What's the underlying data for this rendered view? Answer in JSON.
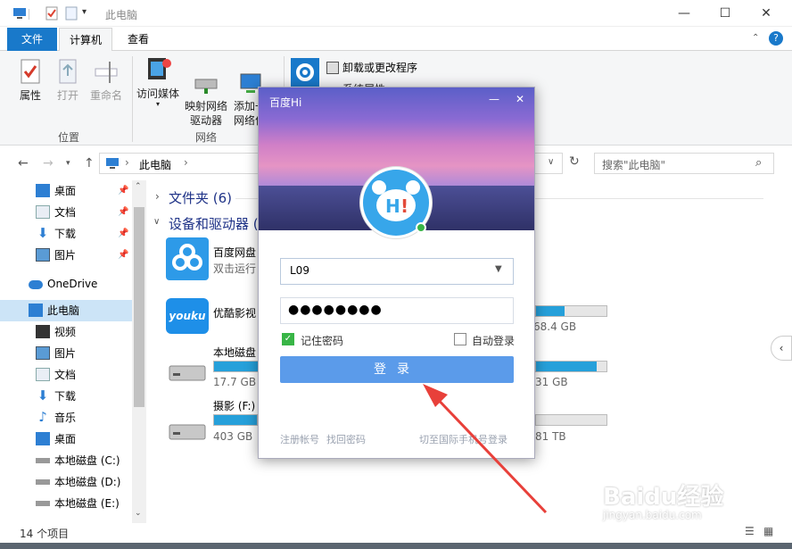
{
  "window": {
    "title": "此电脑",
    "controls": {
      "minimize": "—",
      "maximize": "☐",
      "close": "✕"
    }
  },
  "ribbon_tabs": [
    "文件",
    "计算机",
    "查看"
  ],
  "ribbon": {
    "location_group": {
      "label": "位置",
      "items": [
        "属性",
        "打开",
        "重命名"
      ]
    },
    "network_group": {
      "label": "网络",
      "items": [
        "访问媒体",
        "映射网络\n驱动器",
        "添加一\n网络位"
      ]
    },
    "system_items": [
      "卸载或更改程序",
      "系统属性"
    ]
  },
  "address": {
    "path": "此电脑",
    "search_placeholder": "搜索\"此电脑\""
  },
  "nav": {
    "quick": [
      {
        "label": "桌面",
        "pinned": true
      },
      {
        "label": "文档",
        "pinned": true
      },
      {
        "label": "下载",
        "pinned": true
      },
      {
        "label": "图片",
        "pinned": true
      }
    ],
    "onedrive": "OneDrive",
    "thispc": "此电脑",
    "pc_items": [
      "视频",
      "图片",
      "文档",
      "下载",
      "音乐",
      "桌面",
      "本地磁盘 (C:)",
      "本地磁盘 (D:)",
      "本地磁盘 (E:)"
    ]
  },
  "content": {
    "folders_header": "文件夹 (6)",
    "devices_header": "设备和驱动器 (",
    "items": [
      {
        "name": "百度网盘",
        "sub": "双击运行"
      },
      {
        "name": "优酷影视",
        "sub": ""
      },
      {
        "name": "本地磁盘",
        "sub": "17.7 GB"
      },
      {
        "name": "摄影 (F:)",
        "sub": "403 GB"
      }
    ],
    "right_drives": [
      {
        "size": "68.4 GB",
        "used": 0.4
      },
      {
        "size": "31 GB",
        "used": 0.86
      },
      {
        "size": "81 TB",
        "used": 0.0
      }
    ]
  },
  "status": {
    "count": "14 个项目"
  },
  "dialog": {
    "title": "百度Hi",
    "username": "L09",
    "password_mask": "●●●●●●●●",
    "remember": "记住密码",
    "autologin": "自动登录",
    "login": "登录",
    "register": "注册帐号",
    "forgot": "找回密码",
    "intl": "切至国际手机号登录"
  },
  "watermark": {
    "brand": "Baidu经验",
    "url": "jingyan.baidu.com"
  },
  "colors": {
    "accent": "#1979ca",
    "login": "#5b9bea",
    "arrow": "#e8403a",
    "drive": "#26a0da"
  }
}
